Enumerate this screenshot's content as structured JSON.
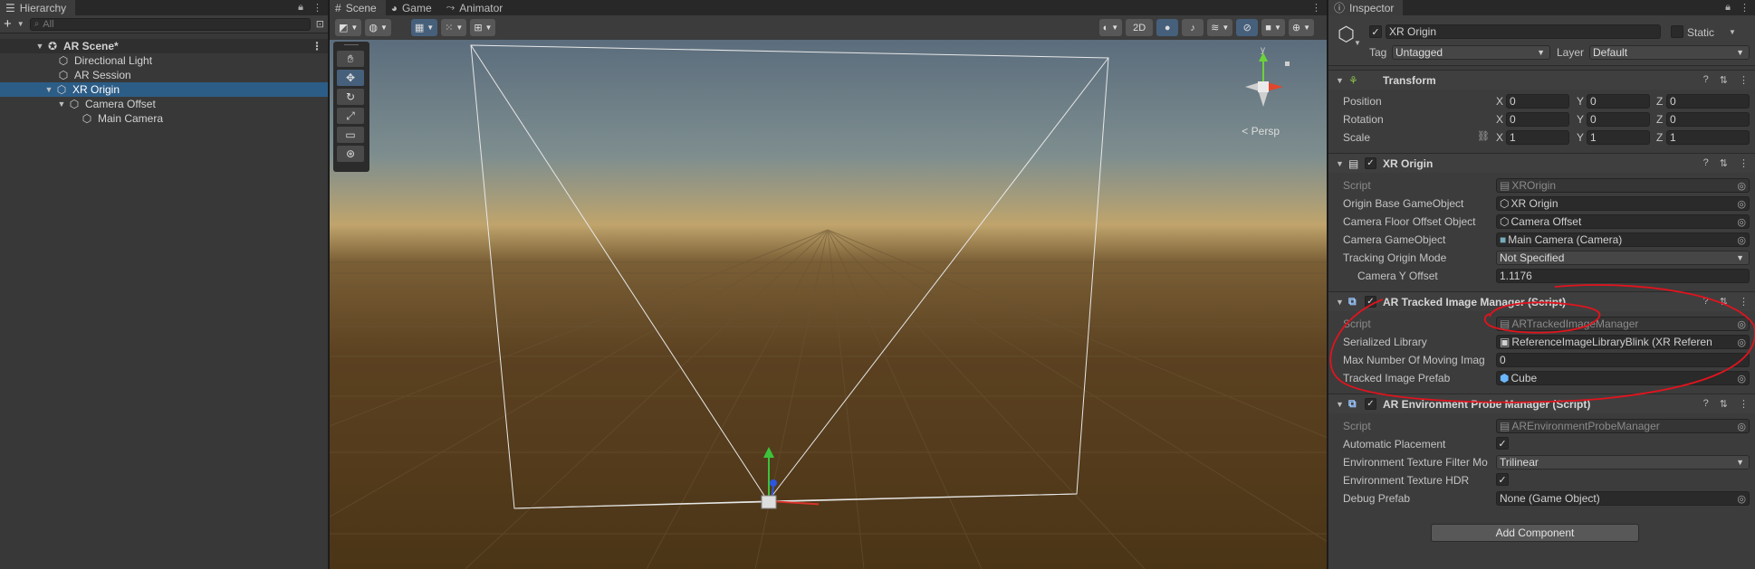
{
  "hierarchy": {
    "tab": "Hierarchy",
    "add": "+",
    "search_placeholder": "All",
    "scene": "AR Scene*",
    "items": [
      {
        "label": "Directional Light"
      },
      {
        "label": "AR Session"
      },
      {
        "label": "XR Origin"
      },
      {
        "label": "Camera Offset"
      },
      {
        "label": "Main Camera"
      }
    ]
  },
  "scene_view": {
    "tabs": [
      "Scene",
      "Game",
      "Animator"
    ],
    "btn_2d": "2D",
    "persp": "< Persp",
    "gizmo_y": "y"
  },
  "inspector": {
    "tab": "Inspector",
    "object_name": "XR Origin",
    "static_label": "Static",
    "tag_label": "Tag",
    "tag_value": "Untagged",
    "layer_label": "Layer",
    "layer_value": "Default",
    "transform": {
      "title": "Transform",
      "position_label": "Position",
      "rotation_label": "Rotation",
      "scale_label": "Scale",
      "axes": [
        "X",
        "Y",
        "Z"
      ],
      "position": [
        "0",
        "0",
        "0"
      ],
      "rotation": [
        "0",
        "0",
        "0"
      ],
      "scale": [
        "1",
        "1",
        "1"
      ]
    },
    "xr_origin": {
      "title": "XR Origin",
      "script_label": "Script",
      "script_value": "XROrigin",
      "origin_base_label": "Origin Base GameObject",
      "origin_base_value": "XR Origin",
      "camera_floor_label": "Camera Floor Offset Object",
      "camera_floor_value": "Camera Offset",
      "camera_go_label": "Camera GameObject",
      "camera_go_value": "Main Camera (Camera)",
      "tracking_label": "Tracking Origin Mode",
      "tracking_value": "Not Specified",
      "camera_y_label": "Camera Y Offset",
      "camera_y_value": "1.1176"
    },
    "tracked_image": {
      "title": "AR Tracked Image Manager (Script)",
      "script_label": "Script",
      "script_value": "ARTrackedImageManager",
      "library_label": "Serialized Library",
      "library_value": "ReferenceImageLibraryBlink (XR Referen",
      "max_label": "Max Number Of Moving Imag",
      "max_value": "0",
      "prefab_label": "Tracked Image Prefab",
      "prefab_value": "Cube"
    },
    "env_probe": {
      "title": "AR Environment Probe Manager (Script)",
      "script_label": "Script",
      "script_value": "AREnvironmentProbeManager",
      "auto_label": "Automatic Placement",
      "filter_label": "Environment Texture Filter Mo",
      "filter_value": "Trilinear",
      "hdr_label": "Environment Texture HDR",
      "debug_label": "Debug Prefab",
      "debug_value": "None (Game Object)"
    },
    "add_component": "Add Component"
  },
  "colors": {
    "selection": "#2c5d87",
    "annotation": "#e0141e"
  }
}
